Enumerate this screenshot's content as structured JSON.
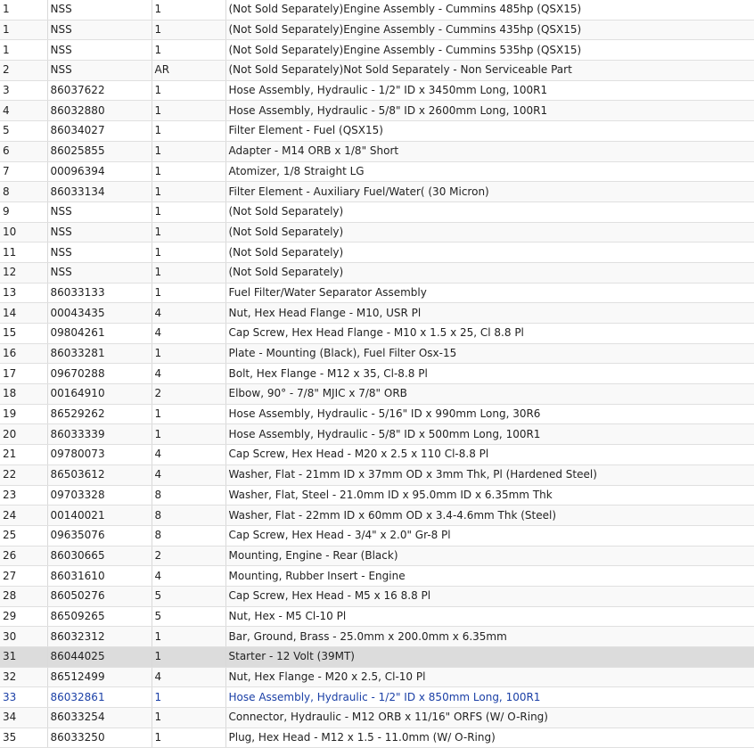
{
  "rows": [
    {
      "item": "1",
      "part": "NSS",
      "qty": "1",
      "desc": "(Not Sold Separately)Engine Assembly - Cummins 485hp (QSX15)"
    },
    {
      "item": "1",
      "part": "NSS",
      "qty": "1",
      "desc": "(Not Sold Separately)Engine Assembly - Cummins 435hp (QSX15)"
    },
    {
      "item": "1",
      "part": "NSS",
      "qty": "1",
      "desc": "(Not Sold Separately)Engine Assembly - Cummins 535hp (QSX15)"
    },
    {
      "item": "2",
      "part": "NSS",
      "qty": "AR",
      "desc": "(Not Sold Separately)Not Sold Separately - Non Serviceable Part"
    },
    {
      "item": "3",
      "part": "86037622",
      "qty": "1",
      "desc": "Hose Assembly, Hydraulic - 1/2\" ID x 3450mm Long, 100R1"
    },
    {
      "item": "4",
      "part": "86032880",
      "qty": "1",
      "desc": "Hose Assembly, Hydraulic - 5/8\" ID x 2600mm Long, 100R1"
    },
    {
      "item": "5",
      "part": "86034027",
      "qty": "1",
      "desc": "Filter Element - Fuel (QSX15)"
    },
    {
      "item": "6",
      "part": "86025855",
      "qty": "1",
      "desc": "Adapter - M14 ORB x 1/8\" Short"
    },
    {
      "item": "7",
      "part": "00096394",
      "qty": "1",
      "desc": "Atomizer, 1/8 Straight LG"
    },
    {
      "item": "8",
      "part": "86033134",
      "qty": "1",
      "desc": "Filter Element - Auxiliary Fuel/Water( (30 Micron)"
    },
    {
      "item": "9",
      "part": "NSS",
      "qty": "1",
      "desc": "(Not Sold Separately)"
    },
    {
      "item": "10",
      "part": "NSS",
      "qty": "1",
      "desc": "(Not Sold Separately)"
    },
    {
      "item": "11",
      "part": "NSS",
      "qty": "1",
      "desc": "(Not Sold Separately)"
    },
    {
      "item": "12",
      "part": "NSS",
      "qty": "1",
      "desc": "(Not Sold Separately)"
    },
    {
      "item": "13",
      "part": "86033133",
      "qty": "1",
      "desc": "Fuel Filter/Water Separator Assembly"
    },
    {
      "item": "14",
      "part": "00043435",
      "qty": "4",
      "desc": "Nut, Hex Head Flange - M10, USR Pl"
    },
    {
      "item": "15",
      "part": "09804261",
      "qty": "4",
      "desc": "Cap Screw, Hex Head Flange - M10 x 1.5 x 25, Cl 8.8 Pl"
    },
    {
      "item": "16",
      "part": "86033281",
      "qty": "1",
      "desc": "Plate - Mounting (Black), Fuel Filter Osx-15"
    },
    {
      "item": "17",
      "part": "09670288",
      "qty": "4",
      "desc": "Bolt, Hex Flange - M12 x 35, Cl-8.8 Pl"
    },
    {
      "item": "18",
      "part": "00164910",
      "qty": "2",
      "desc": "Elbow, 90° - 7/8\" MJIC x 7/8\" ORB"
    },
    {
      "item": "19",
      "part": "86529262",
      "qty": "1",
      "desc": "Hose Assembly, Hydraulic - 5/16\" ID x 990mm Long, 30R6"
    },
    {
      "item": "20",
      "part": "86033339",
      "qty": "1",
      "desc": "Hose Assembly, Hydraulic - 5/8\" ID x 500mm Long, 100R1"
    },
    {
      "item": "21",
      "part": "09780073",
      "qty": "4",
      "desc": "Cap Screw, Hex Head - M20 x 2.5 x 110 Cl-8.8 Pl"
    },
    {
      "item": "22",
      "part": "86503612",
      "qty": "4",
      "desc": "Washer, Flat - 21mm ID x 37mm OD x 3mm Thk, Pl (Hardened Steel)"
    },
    {
      "item": "23",
      "part": "09703328",
      "qty": "8",
      "desc": "Washer, Flat, Steel - 21.0mm ID x 95.0mm ID x 6.35mm Thk"
    },
    {
      "item": "24",
      "part": "00140021",
      "qty": "8",
      "desc": "Washer, Flat - 22mm ID x 60mm OD x 3.4-4.6mm Thk (Steel)"
    },
    {
      "item": "25",
      "part": "09635076",
      "qty": "8",
      "desc": "Cap Screw, Hex Head - 3/4\" x 2.0\" Gr-8 Pl"
    },
    {
      "item": "26",
      "part": "86030665",
      "qty": "2",
      "desc": "Mounting, Engine - Rear (Black)"
    },
    {
      "item": "27",
      "part": "86031610",
      "qty": "4",
      "desc": "Mounting, Rubber Insert - Engine"
    },
    {
      "item": "28",
      "part": "86050276",
      "qty": "5",
      "desc": "Cap Screw, Hex Head - M5 x 16 8.8 Pl"
    },
    {
      "item": "29",
      "part": "86509265",
      "qty": "5",
      "desc": "Nut, Hex - M5 Cl-10 Pl"
    },
    {
      "item": "30",
      "part": "86032312",
      "qty": "1",
      "desc": "Bar, Ground, Brass - 25.0mm x 200.0mm x 6.35mm"
    },
    {
      "item": "31",
      "part": "86044025",
      "qty": "1",
      "desc": "Starter - 12 Volt (39MT)"
    },
    {
      "item": "32",
      "part": "86512499",
      "qty": "4",
      "desc": "Nut, Hex Flange - M20 x 2.5, Cl-10 Pl"
    },
    {
      "item": "33",
      "part": "86032861",
      "qty": "1",
      "desc": "Hose Assembly, Hydraulic - 1/2\" ID x 850mm Long, 100R1"
    },
    {
      "item": "34",
      "part": "86033254",
      "qty": "1",
      "desc": "Connector, Hydraulic - M12 ORB x 11/16\" ORFS (W/ O-Ring)"
    },
    {
      "item": "35",
      "part": "86033250",
      "qty": "1",
      "desc": "Plug, Hex Head - M12 x 1.5 - 11.0mm (W/ O-Ring)"
    }
  ],
  "colors": {
    "highlight_row_bg": "#dcdcdc",
    "link_row_text": "#1a3fa6",
    "text": "#222222"
  }
}
